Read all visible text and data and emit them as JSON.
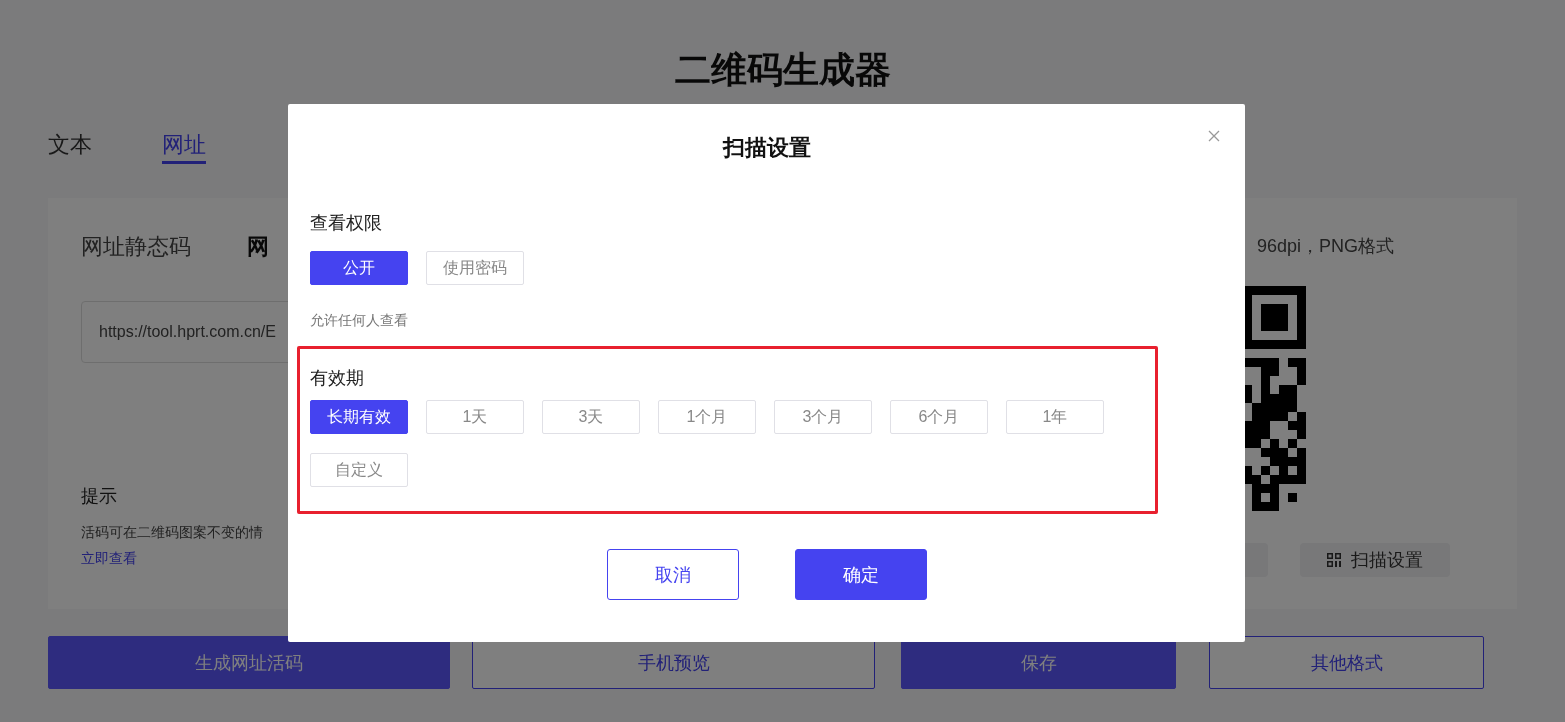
{
  "page": {
    "title": "二维码生成器",
    "tabs": [
      {
        "label": "文本",
        "selected": false
      },
      {
        "label": "网址",
        "selected": true
      }
    ],
    "panel": {
      "modes": [
        {
          "label": "网址静态码",
          "selected": false
        },
        {
          "label": "网",
          "selected": true
        }
      ],
      "url_field": {
        "value": "https://tool.hprt.com.cn/E"
      },
      "tip_title": "提示",
      "tip_text": "活码可在二维码图案不变的情",
      "tip_link": "立即查看",
      "spec": "96dpi，PNG格式",
      "actions": [
        {
          "kind": "blank"
        },
        {
          "kind": "scan",
          "label": "扫描设置"
        }
      ]
    },
    "buttons": [
      {
        "label": "生成网址活码",
        "primary": true
      },
      {
        "label": "手机预览",
        "primary": false
      },
      {
        "label": "保存",
        "primary": true
      },
      {
        "label": "其他格式",
        "primary": false
      }
    ]
  },
  "dialog": {
    "title": "扫描设置",
    "sections": [
      {
        "title": "查看权限",
        "highlighted": false,
        "options": [
          {
            "label": "公开",
            "selected": true
          },
          {
            "label": "使用密码",
            "selected": false
          }
        ],
        "hint": "允许任何人查看"
      },
      {
        "title": "有效期",
        "highlighted": true,
        "options": [
          {
            "label": "长期有效",
            "selected": true
          },
          {
            "label": "1天",
            "selected": false
          },
          {
            "label": "3天",
            "selected": false
          },
          {
            "label": "1个月",
            "selected": false
          },
          {
            "label": "3个月",
            "selected": false
          },
          {
            "label": "6个月",
            "selected": false
          },
          {
            "label": "1年",
            "selected": false
          },
          {
            "label": "自定义",
            "selected": false
          }
        ]
      }
    ],
    "buttons": [
      {
        "label": "取消",
        "primary": false
      },
      {
        "label": "确定",
        "primary": true
      }
    ]
  }
}
